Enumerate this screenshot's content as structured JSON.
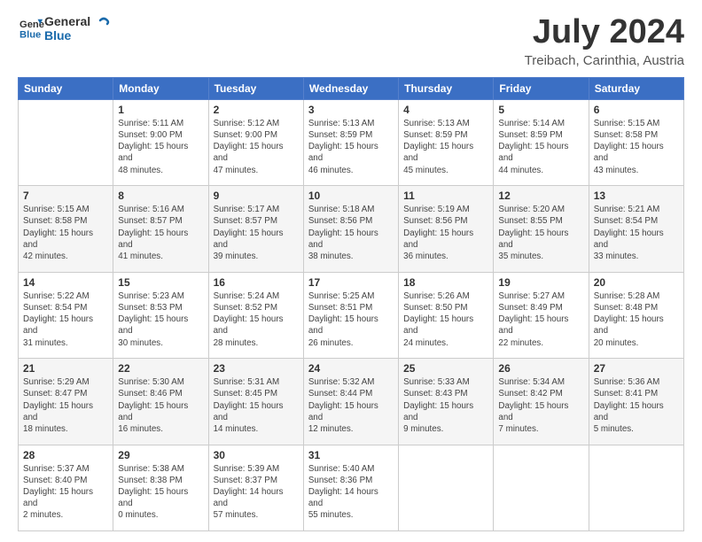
{
  "header": {
    "logo": {
      "general": "General",
      "blue": "Blue"
    },
    "title": "July 2024",
    "subtitle": "Treibach, Carinthia, Austria"
  },
  "columns": [
    "Sunday",
    "Monday",
    "Tuesday",
    "Wednesday",
    "Thursday",
    "Friday",
    "Saturday"
  ],
  "weeks": [
    [
      {
        "day": null
      },
      {
        "day": "1",
        "sunrise": "5:11 AM",
        "sunset": "9:00 PM",
        "daylight": "15 hours and 48 minutes."
      },
      {
        "day": "2",
        "sunrise": "5:12 AM",
        "sunset": "9:00 PM",
        "daylight": "15 hours and 47 minutes."
      },
      {
        "day": "3",
        "sunrise": "5:13 AM",
        "sunset": "8:59 PM",
        "daylight": "15 hours and 46 minutes."
      },
      {
        "day": "4",
        "sunrise": "5:13 AM",
        "sunset": "8:59 PM",
        "daylight": "15 hours and 45 minutes."
      },
      {
        "day": "5",
        "sunrise": "5:14 AM",
        "sunset": "8:59 PM",
        "daylight": "15 hours and 44 minutes."
      },
      {
        "day": "6",
        "sunrise": "5:15 AM",
        "sunset": "8:58 PM",
        "daylight": "15 hours and 43 minutes."
      }
    ],
    [
      {
        "day": "7",
        "sunrise": "5:15 AM",
        "sunset": "8:58 PM",
        "daylight": "15 hours and 42 minutes."
      },
      {
        "day": "8",
        "sunrise": "5:16 AM",
        "sunset": "8:57 PM",
        "daylight": "15 hours and 41 minutes."
      },
      {
        "day": "9",
        "sunrise": "5:17 AM",
        "sunset": "8:57 PM",
        "daylight": "15 hours and 39 minutes."
      },
      {
        "day": "10",
        "sunrise": "5:18 AM",
        "sunset": "8:56 PM",
        "daylight": "15 hours and 38 minutes."
      },
      {
        "day": "11",
        "sunrise": "5:19 AM",
        "sunset": "8:56 PM",
        "daylight": "15 hours and 36 minutes."
      },
      {
        "day": "12",
        "sunrise": "5:20 AM",
        "sunset": "8:55 PM",
        "daylight": "15 hours and 35 minutes."
      },
      {
        "day": "13",
        "sunrise": "5:21 AM",
        "sunset": "8:54 PM",
        "daylight": "15 hours and 33 minutes."
      }
    ],
    [
      {
        "day": "14",
        "sunrise": "5:22 AM",
        "sunset": "8:54 PM",
        "daylight": "15 hours and 31 minutes."
      },
      {
        "day": "15",
        "sunrise": "5:23 AM",
        "sunset": "8:53 PM",
        "daylight": "15 hours and 30 minutes."
      },
      {
        "day": "16",
        "sunrise": "5:24 AM",
        "sunset": "8:52 PM",
        "daylight": "15 hours and 28 minutes."
      },
      {
        "day": "17",
        "sunrise": "5:25 AM",
        "sunset": "8:51 PM",
        "daylight": "15 hours and 26 minutes."
      },
      {
        "day": "18",
        "sunrise": "5:26 AM",
        "sunset": "8:50 PM",
        "daylight": "15 hours and 24 minutes."
      },
      {
        "day": "19",
        "sunrise": "5:27 AM",
        "sunset": "8:49 PM",
        "daylight": "15 hours and 22 minutes."
      },
      {
        "day": "20",
        "sunrise": "5:28 AM",
        "sunset": "8:48 PM",
        "daylight": "15 hours and 20 minutes."
      }
    ],
    [
      {
        "day": "21",
        "sunrise": "5:29 AM",
        "sunset": "8:47 PM",
        "daylight": "15 hours and 18 minutes."
      },
      {
        "day": "22",
        "sunrise": "5:30 AM",
        "sunset": "8:46 PM",
        "daylight": "15 hours and 16 minutes."
      },
      {
        "day": "23",
        "sunrise": "5:31 AM",
        "sunset": "8:45 PM",
        "daylight": "15 hours and 14 minutes."
      },
      {
        "day": "24",
        "sunrise": "5:32 AM",
        "sunset": "8:44 PM",
        "daylight": "15 hours and 12 minutes."
      },
      {
        "day": "25",
        "sunrise": "5:33 AM",
        "sunset": "8:43 PM",
        "daylight": "15 hours and 9 minutes."
      },
      {
        "day": "26",
        "sunrise": "5:34 AM",
        "sunset": "8:42 PM",
        "daylight": "15 hours and 7 minutes."
      },
      {
        "day": "27",
        "sunrise": "5:36 AM",
        "sunset": "8:41 PM",
        "daylight": "15 hours and 5 minutes."
      }
    ],
    [
      {
        "day": "28",
        "sunrise": "5:37 AM",
        "sunset": "8:40 PM",
        "daylight": "15 hours and 2 minutes."
      },
      {
        "day": "29",
        "sunrise": "5:38 AM",
        "sunset": "8:38 PM",
        "daylight": "15 hours and 0 minutes."
      },
      {
        "day": "30",
        "sunrise": "5:39 AM",
        "sunset": "8:37 PM",
        "daylight": "14 hours and 57 minutes."
      },
      {
        "day": "31",
        "sunrise": "5:40 AM",
        "sunset": "8:36 PM",
        "daylight": "14 hours and 55 minutes."
      },
      {
        "day": null
      },
      {
        "day": null
      },
      {
        "day": null
      }
    ]
  ],
  "sunrise_label": "Sunrise:",
  "sunset_label": "Sunset:",
  "daylight_label": "Daylight:"
}
